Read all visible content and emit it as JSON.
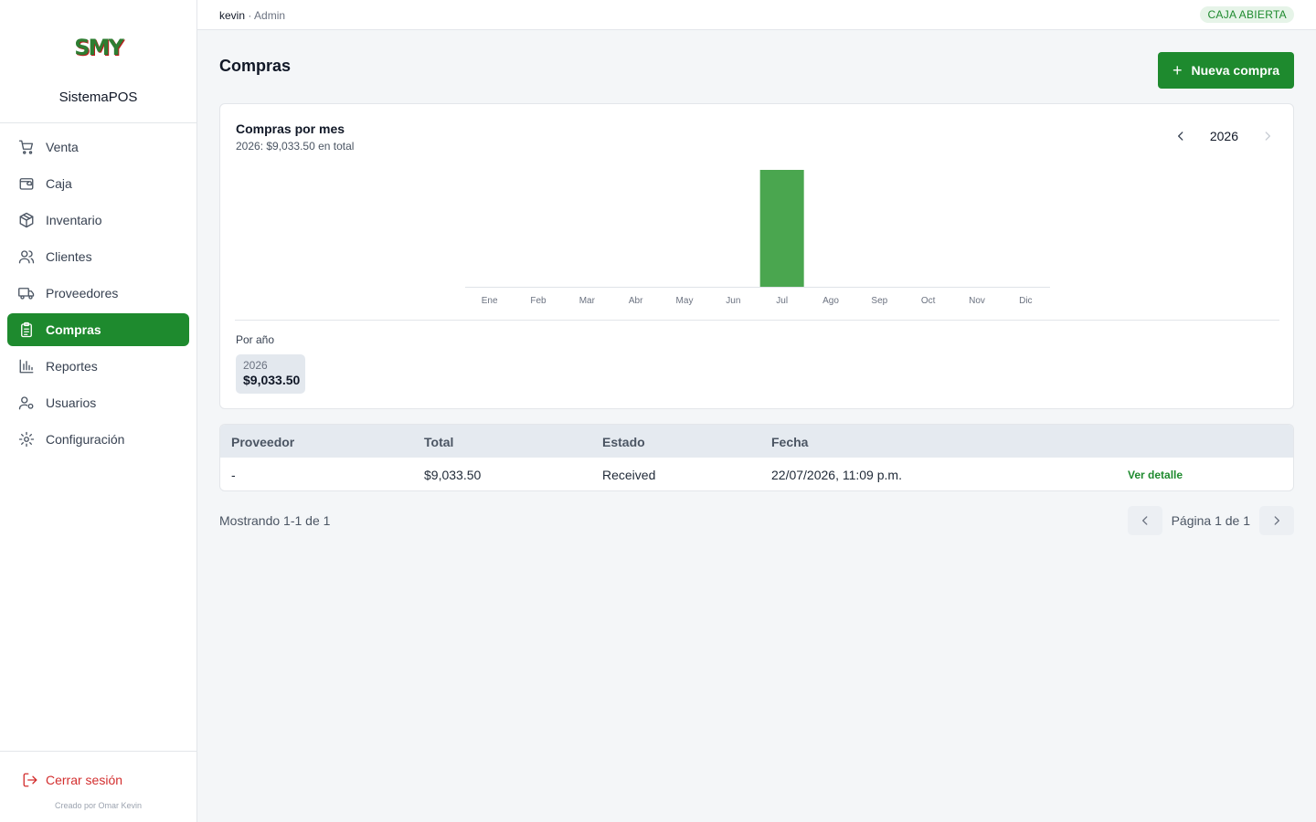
{
  "brand": {
    "logo_text": "SMY",
    "name": "SistemaPOS"
  },
  "sidebar": {
    "items": [
      {
        "label": "Venta",
        "icon": "cart-icon"
      },
      {
        "label": "Caja",
        "icon": "wallet-icon"
      },
      {
        "label": "Inventario",
        "icon": "box-icon"
      },
      {
        "label": "Clientes",
        "icon": "users-icon"
      },
      {
        "label": "Proveedores",
        "icon": "truck-icon"
      },
      {
        "label": "Compras",
        "icon": "clipboard-icon",
        "active": true
      },
      {
        "label": "Reportes",
        "icon": "bar-chart-icon"
      },
      {
        "label": "Usuarios",
        "icon": "user-settings-icon"
      },
      {
        "label": "Configuración",
        "icon": "gear-icon"
      }
    ],
    "logout_label": "Cerrar sesión",
    "credit": "Creado por Omar Kevin"
  },
  "topbar": {
    "user_name": "kevin",
    "separator": " · ",
    "role": "Admin",
    "status_badge": "CAJA ABIERTA"
  },
  "page": {
    "title": "Compras",
    "new_button_label": "Nueva compra"
  },
  "chart_card": {
    "title": "Compras por mes",
    "subtitle": "2026: $9,033.50 en total",
    "year": "2026",
    "por_ano_label": "Por año",
    "year_chip": {
      "year": "2026",
      "value": "$9,033.50"
    }
  },
  "chart_data": {
    "type": "bar",
    "categories": [
      "Ene",
      "Feb",
      "Mar",
      "Abr",
      "May",
      "Jun",
      "Jul",
      "Ago",
      "Sep",
      "Oct",
      "Nov",
      "Dic"
    ],
    "values": [
      0,
      0,
      0,
      0,
      0,
      0,
      9033.5,
      0,
      0,
      0,
      0,
      0
    ],
    "title": "Compras por mes",
    "xlabel": "",
    "ylabel": "",
    "ylim": [
      0,
      9033.5
    ],
    "grid": false,
    "color": "#4aa64f"
  },
  "table": {
    "headers": [
      "Proveedor",
      "Total",
      "Estado",
      "Fecha"
    ],
    "rows": [
      {
        "proveedor": "-",
        "total": "$9,033.50",
        "estado": "Received",
        "fecha": "22/07/2026, 11:09 p.m.",
        "action": "Ver detalle"
      }
    ]
  },
  "pagination": {
    "showing": "Mostrando 1-1 de 1",
    "page_label": "Página 1 de 1"
  },
  "colors": {
    "accent": "#1e8a2e",
    "bar": "#4aa64f",
    "danger": "#d32f2f"
  }
}
